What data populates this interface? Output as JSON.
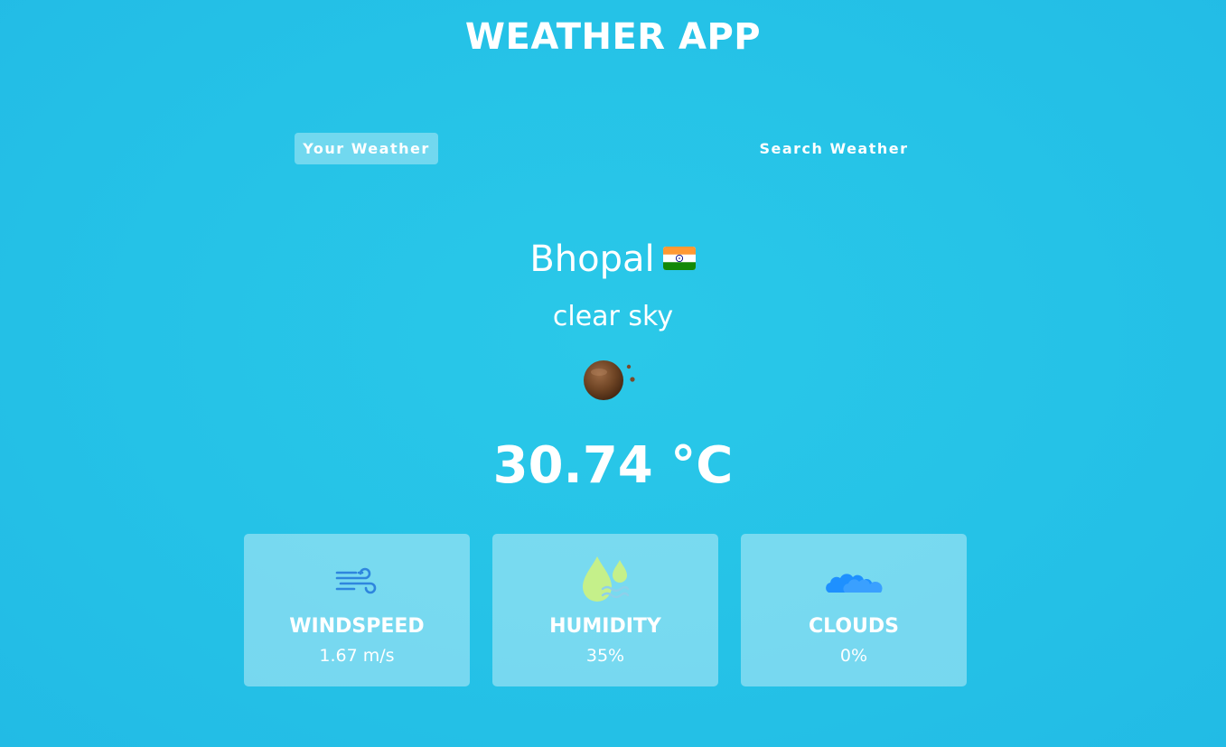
{
  "app": {
    "title": "WEATHER APP"
  },
  "tabs": [
    {
      "label": "Your Weather",
      "active": true
    },
    {
      "label": "Search Weather",
      "active": false
    }
  ],
  "weather": {
    "city": "Bhopal",
    "country_flag": "india-flag-icon",
    "description": "clear sky",
    "icon": "clear-sky-icon",
    "temperature": "30.74 °C"
  },
  "stats": {
    "windspeed": {
      "label": "WINDSPEED",
      "value": "1.67 m/s",
      "icon": "wind-icon"
    },
    "humidity": {
      "label": "HUMIDITY",
      "value": "35%",
      "icon": "humidity-icon"
    },
    "clouds": {
      "label": "CLOUDS",
      "value": "0%",
      "icon": "cloud-icon"
    }
  },
  "colors": {
    "background": "#25c2e7",
    "text": "#ffffff",
    "card": "rgba(255,255,255,0.38)",
    "wind_icon": "#2e86de",
    "humidity_icon": "#c5f08a",
    "cloud_icon": "#1e90ff"
  }
}
